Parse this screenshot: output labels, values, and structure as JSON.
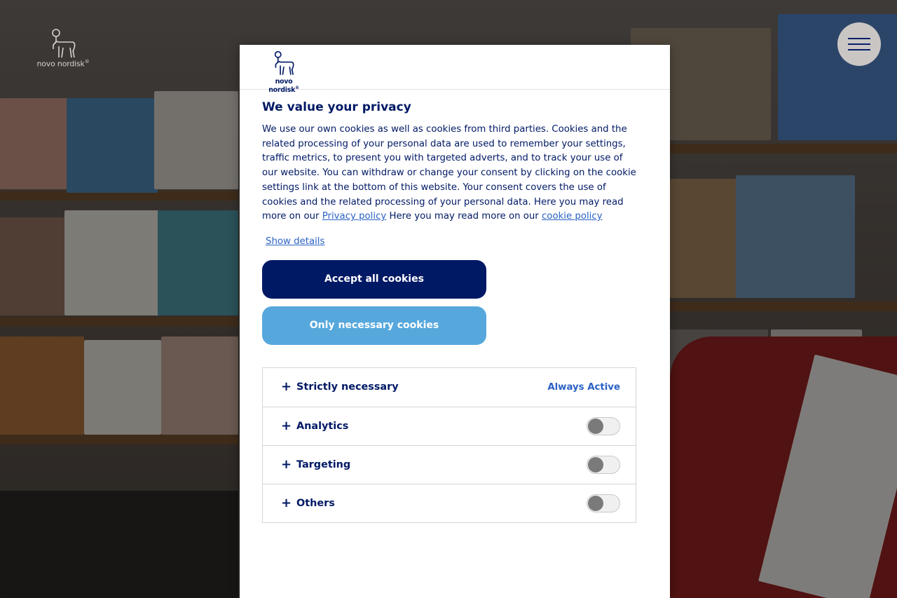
{
  "brand": {
    "name": "novo nordisk",
    "registered": "®",
    "color": "#001965"
  },
  "menu": {
    "icon": "hamburger-icon"
  },
  "dialog": {
    "title": "We value your privacy",
    "description": "We use our own cookies as well as cookies from third parties. Cookies and the related processing of your personal data are used to remember your settings, traffic metrics, to present you with targeted adverts, and to track your use of our website. You can withdraw or change your consent by clicking on the cookie settings link at the bottom of this website. Your consent covers the use of cookies and the related processing of your personal data. Here you may read more on our",
    "privacy_link": "Privacy policy",
    "cookie_text": "Here you may read more on our",
    "cookie_link": "cookie policy",
    "show_details": "Show details",
    "accept_all": "Accept all cookies",
    "only_necessary": "Only necessary cookies",
    "categories": [
      {
        "label": "Strictly necessary",
        "status": "Always Active",
        "icon": "plus-icon"
      },
      {
        "label": "Analytics",
        "enabled": false,
        "icon": "plus-icon"
      },
      {
        "label": "Targeting",
        "enabled": false,
        "icon": "plus-icon"
      },
      {
        "label": "Others",
        "enabled": false,
        "icon": "plus-icon"
      }
    ]
  },
  "colors": {
    "primary": "#001965",
    "secondary": "#56a8dc",
    "link": "#2a62c4"
  }
}
